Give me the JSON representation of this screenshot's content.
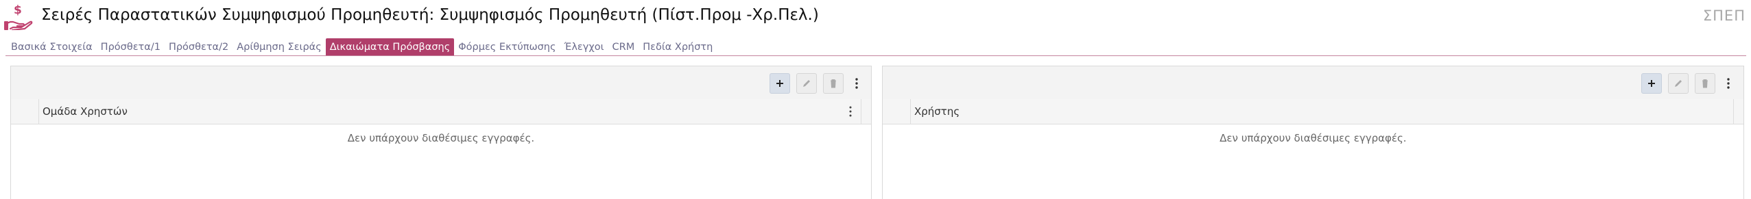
{
  "header": {
    "title": "Σειρές Παραστατικών Συμψηφισμού Προμηθευτή: Συμψηφισμός Προμηθευτή (Πίστ.Προμ -Χρ.Πελ.)",
    "code": "ΣΠΕΠ",
    "icon": "hand-money-icon"
  },
  "tabs": [
    {
      "label": "Βασικά Στοιχεία",
      "active": false
    },
    {
      "label": "Πρόσθετα/1",
      "active": false
    },
    {
      "label": "Πρόσθετα/2",
      "active": false
    },
    {
      "label": "Αρίθμηση Σειράς",
      "active": false
    },
    {
      "label": "Δικαιώματα Πρόσβασης",
      "active": true
    },
    {
      "label": "Φόρμες Εκτύπωσης",
      "active": false
    },
    {
      "label": "Έλεγχοι",
      "active": false
    },
    {
      "label": "CRM",
      "active": false
    },
    {
      "label": "Πεδία Χρήστη",
      "active": false
    }
  ],
  "left_grid": {
    "column_header": "Ομάδα Χρηστών",
    "empty_message": "Δεν υπάρχουν διαθέσιμες εγγραφές."
  },
  "right_grid": {
    "column_header": "Χρήστης",
    "empty_message": "Δεν υπάρχουν διαθέσιμες εγγραφές."
  },
  "colors": {
    "accent": "#b03e6a",
    "tab_text": "#6a6a8a",
    "icon": "#c0426f"
  }
}
